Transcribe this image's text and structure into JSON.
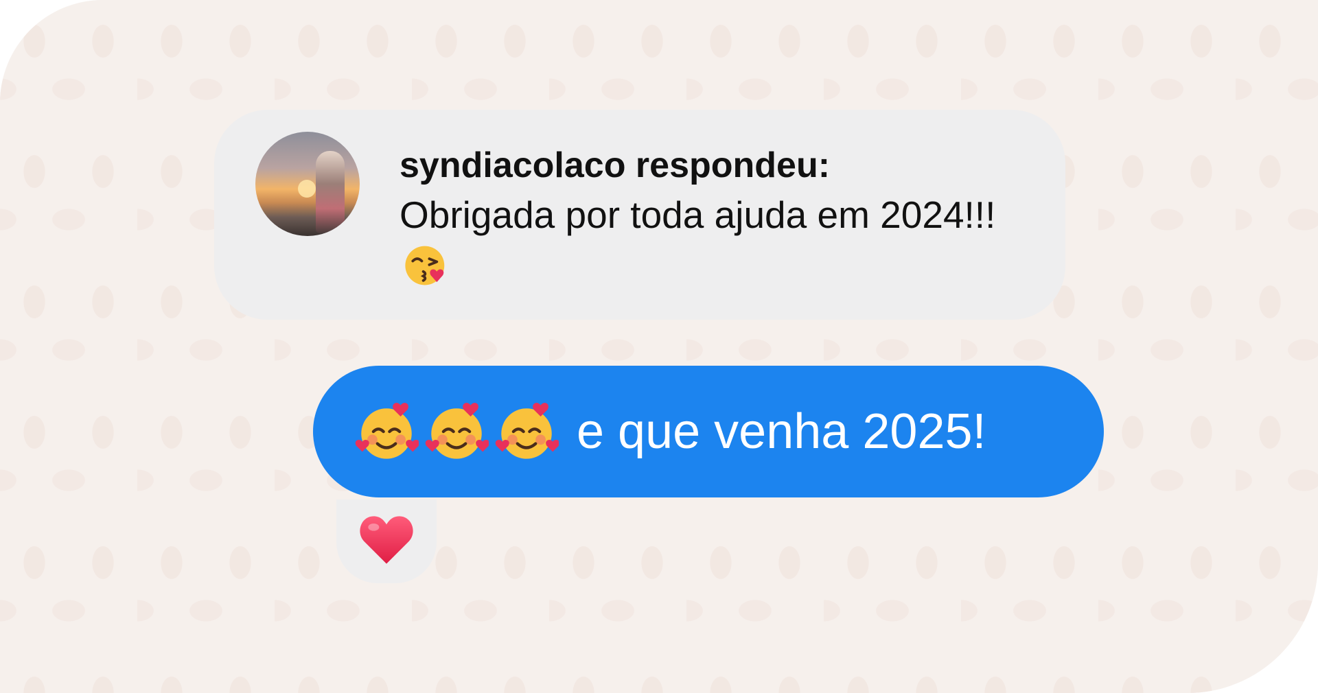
{
  "reply": {
    "author_line": "syndiacolaco respondeu:",
    "message": "Obrigada por toda ajuda em 2024!!!",
    "trailing_emoji": "kissing-face-icon"
  },
  "sent": {
    "emojis": [
      "smiling-face-with-hearts-icon",
      "smiling-face-with-hearts-icon",
      "smiling-face-with-hearts-icon"
    ],
    "text": "e que venha 2025!"
  },
  "reaction": {
    "emoji": "red-heart-icon"
  },
  "colors": {
    "sent_bubble": "#1c84ef",
    "received_bubble": "#eeeeef",
    "background": "#f6f0ec"
  }
}
